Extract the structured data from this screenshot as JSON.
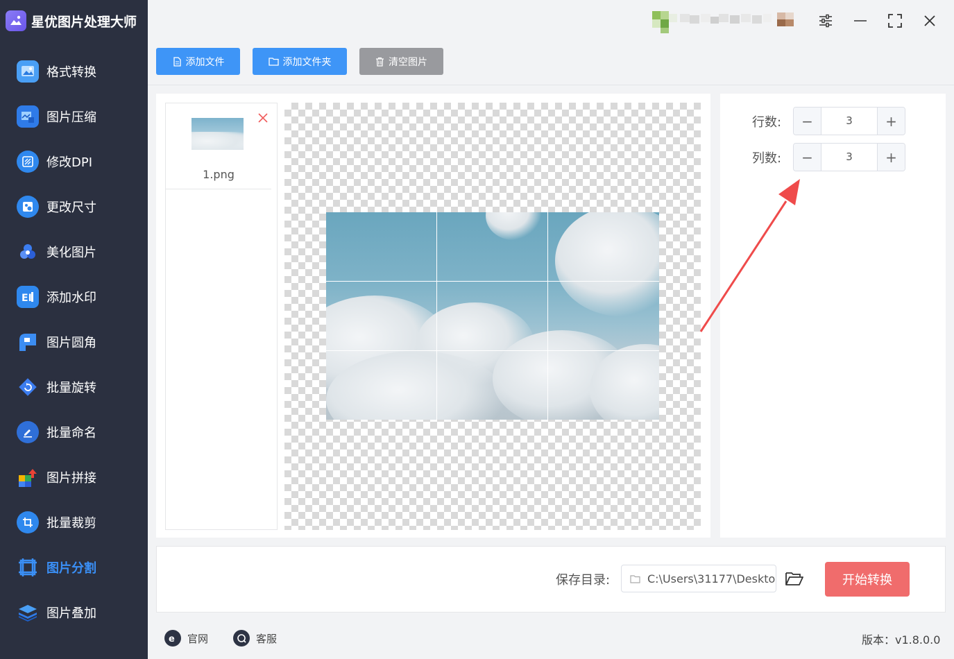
{
  "app": {
    "title": "星优图片处理大师"
  },
  "sidebar": {
    "items": [
      {
        "label": "格式转换",
        "icon": "image-convert-icon",
        "active": false
      },
      {
        "label": "图片压缩",
        "icon": "image-compress-icon",
        "active": false
      },
      {
        "label": "修改DPI",
        "icon": "dpi-icon",
        "active": false
      },
      {
        "label": "更改尺寸",
        "icon": "resize-icon",
        "active": false
      },
      {
        "label": "美化图片",
        "icon": "beautify-icon",
        "active": false
      },
      {
        "label": "添加水印",
        "icon": "watermark-icon",
        "active": false
      },
      {
        "label": "图片圆角",
        "icon": "rounded-corner-icon",
        "active": false
      },
      {
        "label": "批量旋转",
        "icon": "rotate-icon",
        "active": false
      },
      {
        "label": "批量命名",
        "icon": "rename-icon",
        "active": false
      },
      {
        "label": "图片拼接",
        "icon": "stitch-icon",
        "active": false
      },
      {
        "label": "批量裁剪",
        "icon": "crop-icon",
        "active": false
      },
      {
        "label": "图片分割",
        "icon": "split-icon",
        "active": true
      },
      {
        "label": "图片叠加",
        "icon": "layers-icon",
        "active": false
      }
    ]
  },
  "toolbar": {
    "add_file": "添加文件",
    "add_folder": "添加文件夹",
    "clear": "清空图片"
  },
  "files": [
    {
      "name": "1.png"
    }
  ],
  "split": {
    "rows_label": "行数:",
    "rows": "3",
    "cols_label": "列数:",
    "cols": "3"
  },
  "output": {
    "save_label": "保存目录:",
    "path": "C:\\Users\\31177\\Deskto",
    "start_button": "开始转换"
  },
  "footer": {
    "website": "官网",
    "support": "客服",
    "version": "版本：v1.8.0.0"
  },
  "colors": {
    "sidebar_bg": "#2b3040",
    "accent": "#3e95f7",
    "start": "#f06c6c",
    "arrow": "#ef4b4b"
  }
}
